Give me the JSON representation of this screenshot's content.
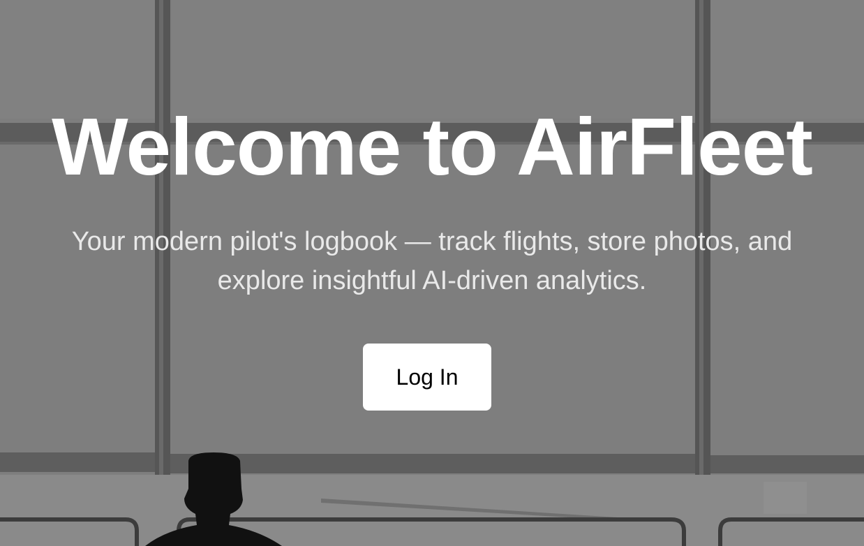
{
  "hero": {
    "title": "Welcome to AirFleet",
    "subtitle": "Your modern pilot's logbook — track flights, store photos, and explore insightful AI-driven analytics.",
    "login_label": "Log In"
  },
  "colors": {
    "overlay_gray": "#7d7d7d",
    "title_text": "#ffffff",
    "subtitle_text": "#e9e9e9",
    "button_bg": "#ffffff",
    "button_text": "#000000"
  }
}
